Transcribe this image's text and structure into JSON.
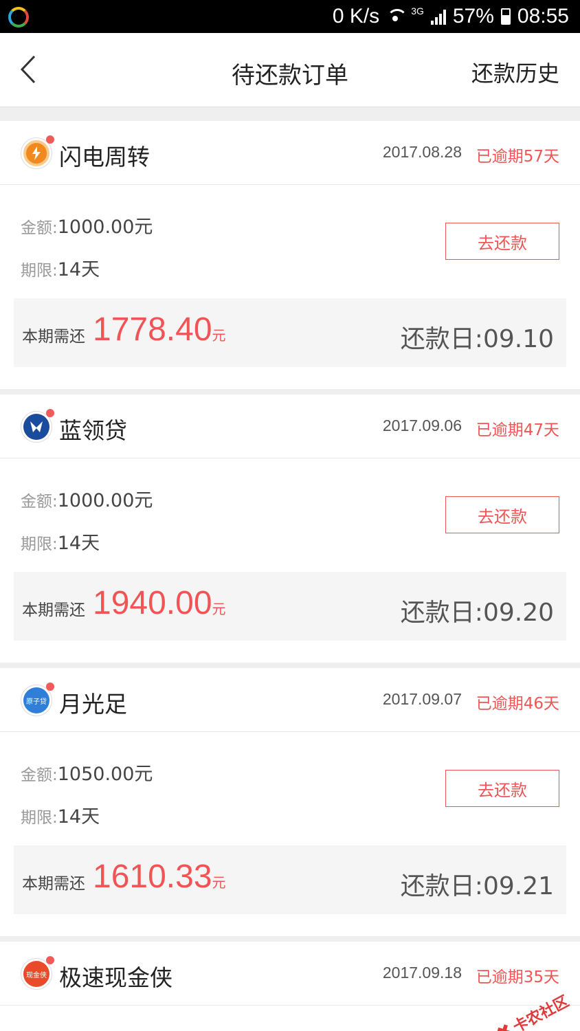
{
  "status": {
    "speed": "0 K/s",
    "network": "3G",
    "battery": "57%",
    "time": "08:55"
  },
  "nav": {
    "title": "待还款订单",
    "history": "还款历史"
  },
  "labels": {
    "amount": "金额:",
    "term": "期限:",
    "due": "本期需还",
    "unit": "元",
    "repay_btn": "去还款",
    "due_date_prefix": "还款日:"
  },
  "orders": [
    {
      "name": "闪电周转",
      "date": "2017.08.28",
      "overdue": "已逾期57天",
      "amount": "1000.00元",
      "term": "14天",
      "due_amount": "1778.40",
      "due_date": "09.10",
      "logo": "lightning-logo-icon"
    },
    {
      "name": "蓝领贷",
      "date": "2017.09.06",
      "overdue": "已逾期47天",
      "amount": "1000.00元",
      "term": "14天",
      "due_amount": "1940.00",
      "due_date": "09.20",
      "logo": "bluecollar-logo-icon"
    },
    {
      "name": "月光足",
      "date": "2017.09.07",
      "overdue": "已逾期46天",
      "amount": "1050.00元",
      "term": "14天",
      "due_amount": "1610.33",
      "due_date": "09.21",
      "logo": "moonlight-logo-icon",
      "logo_text": "原子贷"
    },
    {
      "name": "极速现金侠",
      "date": "2017.09.18",
      "overdue": "已逾期35天",
      "logo": "cashhero-logo-icon",
      "logo_text": "现金侠"
    }
  ],
  "watermark": "卡农社区",
  "colors": {
    "accent_red": "#f05454",
    "background": "#efefef"
  }
}
